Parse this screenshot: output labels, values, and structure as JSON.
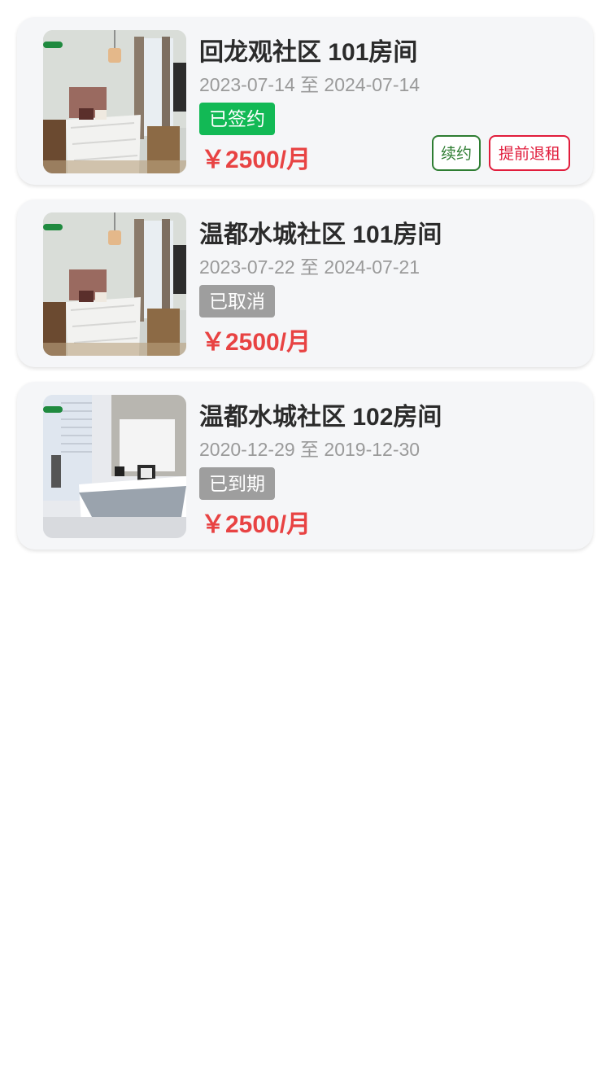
{
  "colors": {
    "signed": "#12b955",
    "inactive": "#9e9e9e",
    "price": "#e84343",
    "renew": "#2e7d32",
    "terminate": "#e11d3c"
  },
  "leases": [
    {
      "title": "回龙观社区 101房间",
      "dates": "2023-07-14 至 2024-07-14",
      "status": "已签约",
      "status_color": "#12b955",
      "price": "￥2500/月",
      "image": "bedroom-photo",
      "actions": {
        "renew": "续约",
        "terminate": "提前退租"
      }
    },
    {
      "title": "温都水城社区 101房间",
      "dates": "2023-07-22 至 2024-07-21",
      "status": "已取消",
      "status_color": "#9e9e9e",
      "price": "￥2500/月",
      "image": "bedroom-photo"
    },
    {
      "title": "温都水城社区 102房间",
      "dates": "2020-12-29 至 2019-12-30",
      "status": "已到期",
      "status_color": "#9e9e9e",
      "price": "￥2500/月",
      "image": "white-bedroom-photo"
    }
  ]
}
